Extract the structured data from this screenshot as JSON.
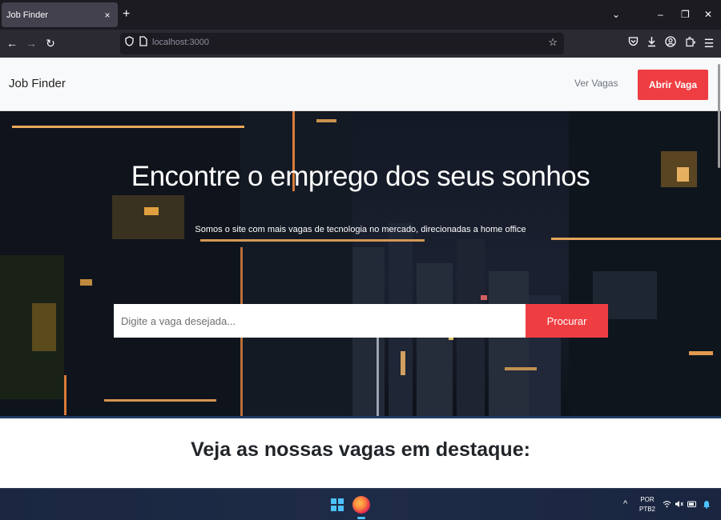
{
  "browser": {
    "tab_title": "Job Finder",
    "tab_close": "×",
    "new_tab": "+",
    "url": "localhost:3000",
    "win_controls": {
      "list": "⌄",
      "minimize": "–",
      "restore": "❐",
      "close": "✕"
    },
    "nav": {
      "back": "←",
      "forward": "→",
      "reload": "↻"
    },
    "toolbar_icons": [
      "pocket-icon",
      "download-icon",
      "account-icon",
      "extensions-icon",
      "menu-icon"
    ]
  },
  "site": {
    "brand": "Job Finder",
    "nav_link": "Ver Vagas",
    "cta": "Abrir Vaga"
  },
  "hero": {
    "title": "Encontre o emprego dos seus sonhos",
    "subtitle": "Somos o site com mais vagas de tecnologia no mercado, direcionadas a home office",
    "search_placeholder": "Digite a vaga desejada...",
    "search_button": "Procurar"
  },
  "featured": {
    "heading": "Veja as nossas vagas em destaque:"
  },
  "taskbar": {
    "lang_top": "POR",
    "lang_bottom": "PTB2",
    "caret": "^"
  },
  "colors": {
    "accent": "#ef3e42",
    "header_bg": "#f8f9fa",
    "hero_border": "#1d3a63",
    "chrome_dark": "#1c1b22",
    "chrome_bar": "#2b2a33"
  }
}
